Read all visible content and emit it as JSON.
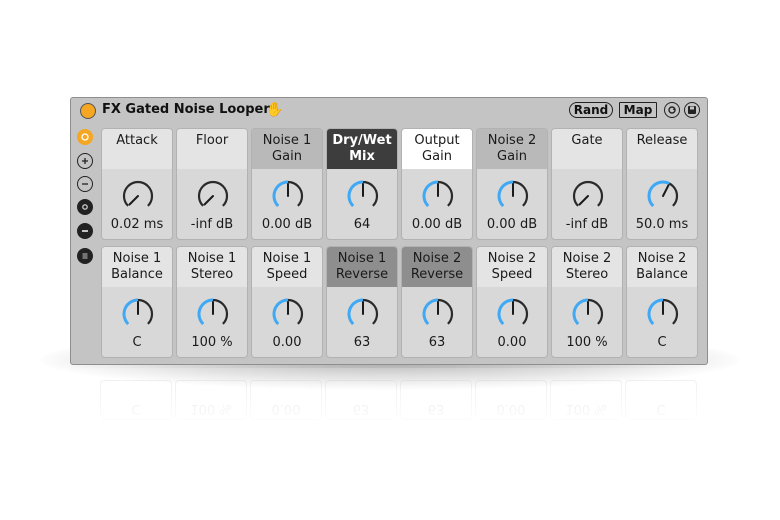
{
  "device": {
    "title": "FX Gated Noise Looper",
    "rand_label": "Rand",
    "map_label": "Map"
  },
  "colors": {
    "accent": "#f5a623",
    "knob_arc": "#3fa9f5",
    "dark_header": "#3d3d3d"
  },
  "row1": [
    {
      "label": "Attack",
      "value": "0.02 ms",
      "style": "light",
      "level": 0.0
    },
    {
      "label": "Floor",
      "value": "-inf dB",
      "style": "light",
      "level": 0.0
    },
    {
      "label": "Noise 1\nGain",
      "value": "0.00 dB",
      "style": "grey",
      "level": 0.5
    },
    {
      "label": "Dry/Wet\nMix",
      "value": "64",
      "style": "dark",
      "level": 0.5
    },
    {
      "label": "Output\nGain",
      "value": "0.00 dB",
      "style": "white",
      "level": 0.5
    },
    {
      "label": "Noise 2\nGain",
      "value": "0.00 dB",
      "style": "grey",
      "level": 0.5
    },
    {
      "label": "Gate",
      "value": "-inf dB",
      "style": "light",
      "level": 0.0
    },
    {
      "label": "Release",
      "value": "50.0 ms",
      "style": "light",
      "level": 0.6
    }
  ],
  "row2": [
    {
      "label": "Noise 1\nBalance",
      "value": "C",
      "style": "light",
      "level": 0.5
    },
    {
      "label": "Noise 1\nStereo",
      "value": "100 %",
      "style": "light",
      "level": 0.5
    },
    {
      "label": "Noise 1\nSpeed",
      "value": "0.00",
      "style": "light",
      "level": 0.5
    },
    {
      "label": "Noise 1\nReverse",
      "value": "63",
      "style": "mid",
      "level": 0.5
    },
    {
      "label": "Noise 2\nReverse",
      "value": "63",
      "style": "mid",
      "level": 0.5
    },
    {
      "label": "Noise 2\nSpeed",
      "value": "0.00",
      "style": "light",
      "level": 0.5
    },
    {
      "label": "Noise 2\nStereo",
      "value": "100 %",
      "style": "light",
      "level": 0.5
    },
    {
      "label": "Noise 2\nBalance",
      "value": "C",
      "style": "light",
      "level": 0.5
    }
  ],
  "sidebar_icons": [
    "hot-swap-icon",
    "plus-icon",
    "minus-icon",
    "settings-icon",
    "minimize-icon",
    "list-icon"
  ]
}
